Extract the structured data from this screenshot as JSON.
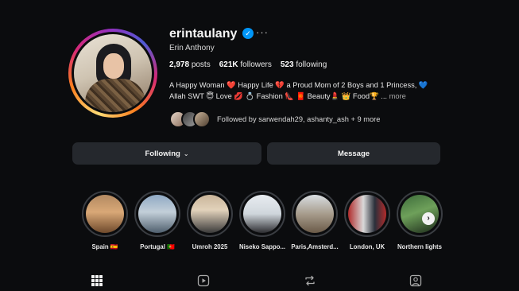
{
  "profile": {
    "username": "erintaulany",
    "verified_mark": "✓",
    "more_label": "···",
    "full_name": "Erin Anthony",
    "stats": {
      "posts_value": "2,978",
      "posts_label": "posts",
      "followers_value": "621K",
      "followers_label": "followers",
      "following_value": "523",
      "following_label": "following"
    },
    "bio_line1": "A Happy Woman ❤️  Happy Life 💔  a Proud Mom of 2 Boys and 1 Princess, 💙",
    "bio_line2": "Allah SWT 😇  Love 💋 💍  Fashion 👠 🧧  Beauty💄 👑  Food🏆 ...",
    "bio_more": "more",
    "followed_by": "Followed by sarwendah29, ashanty_ash + 9 more"
  },
  "actions": {
    "following_label": "Following",
    "following_chevron": "⌄",
    "message_label": "Message"
  },
  "highlights": [
    {
      "label": "Spain 🇪🇸"
    },
    {
      "label": "Portugal 🇵🇹"
    },
    {
      "label": "Umroh 2025"
    },
    {
      "label": "Niseko Sappo..."
    },
    {
      "label": "Paris,Amsterd..."
    },
    {
      "label": "London, UK"
    },
    {
      "label": "Northern lights"
    }
  ],
  "next_arrow": "›",
  "tabs": [
    "posts-grid",
    "reels",
    "reposts",
    "tagged"
  ],
  "colors": {
    "background": "#0b0c0e",
    "button_bg": "#25282d",
    "verified_blue": "#0095f6"
  }
}
